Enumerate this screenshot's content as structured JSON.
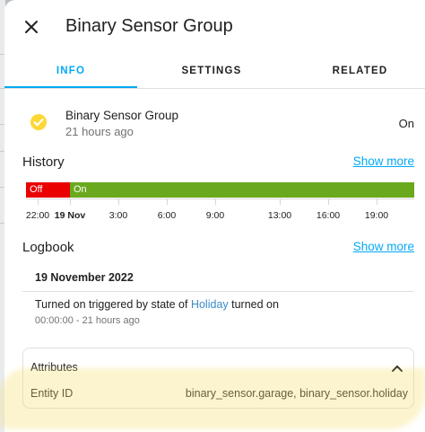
{
  "dialog": {
    "title": "Binary Sensor Group"
  },
  "tabs": [
    {
      "label": "INFO",
      "active": true
    },
    {
      "label": "SETTINGS",
      "active": false
    },
    {
      "label": "RELATED",
      "active": false
    }
  ],
  "entity": {
    "name": "Binary Sensor Group",
    "last_changed": "21 hours ago",
    "state": "On",
    "icon": "check-circle-icon",
    "icon_color": "#fdd835"
  },
  "history": {
    "title": "History",
    "show_more": "Show more",
    "segments": [
      {
        "label": "Off",
        "color": "#ea0000"
      },
      {
        "label": "On",
        "color": "#6aa81e"
      }
    ],
    "axis_labels": [
      "22:00",
      "19 Nov",
      "3:00",
      "6:00",
      "9:00",
      "13:00",
      "16:00",
      "19:00"
    ]
  },
  "logbook": {
    "title": "Logbook",
    "show_more": "Show more",
    "date": "19 November 2022",
    "entry": {
      "text_before": "Turned on triggered by state of ",
      "link": "Holiday",
      "text_after": " turned on",
      "time": "00:00:00 - 21 hours ago"
    }
  },
  "attributes": {
    "title": "Attributes",
    "expanded": true,
    "rows": [
      {
        "key": "Entity ID",
        "value": "binary_sensor.garage, binary_sensor.holiday"
      }
    ]
  },
  "colors": {
    "accent": "#03a9f4",
    "link": "#3a8bc9"
  }
}
